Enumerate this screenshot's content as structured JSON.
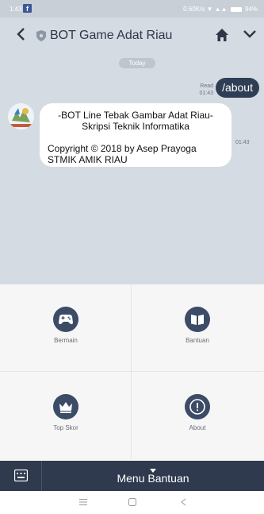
{
  "status_bar": {
    "time": "1:43",
    "net_speed": "0.60K/s",
    "battery": "94%"
  },
  "header": {
    "title": "BOT Game Adat Riau"
  },
  "chat": {
    "date_label": "Today",
    "outgoing": {
      "read_label": "Read",
      "time": "01:43",
      "text": "/about"
    },
    "incoming": {
      "line1": "-BOT Line Tebak Gambar Adat Riau-",
      "line2": "Skripsi Teknik Informatika",
      "line3": "Copyright © 2018 by Asep Prayoga",
      "line4": "STMIK AMIK RIAU",
      "time": "01:43"
    }
  },
  "menu": {
    "items": [
      {
        "label": "Bermain",
        "icon": "gamepad-icon"
      },
      {
        "label": "Bantuan",
        "icon": "book-icon"
      },
      {
        "label": "Top Skor",
        "icon": "crown-icon"
      },
      {
        "label": "About",
        "icon": "info-icon"
      }
    ]
  },
  "bottom_bar": {
    "label": "Menu Bantuan"
  },
  "colors": {
    "header_bg": "#d5dbe3",
    "outgoing_bubble": "#2f3e55",
    "menu_icon_bg": "#3c4b66",
    "bottom_bar_bg": "#2f3a4e"
  }
}
